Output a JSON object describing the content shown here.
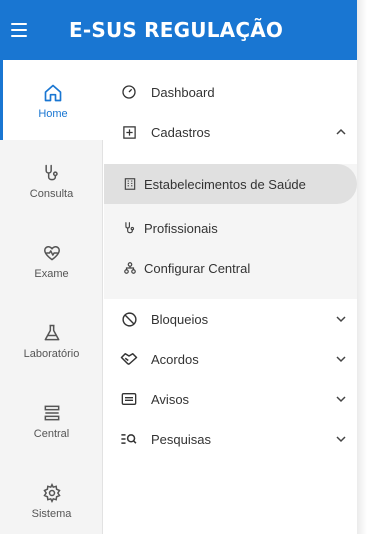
{
  "header": {
    "title": "E-SUS REGULAÇÃO",
    "menu_icon": "hamburger-icon"
  },
  "rail": {
    "items": [
      {
        "label": "Home",
        "icon": "home-icon",
        "active": true
      },
      {
        "label": "Consulta",
        "icon": "stethoscope-icon"
      },
      {
        "label": "Exame",
        "icon": "heart-pulse-icon"
      },
      {
        "label": "Laboratório",
        "icon": "flask-icon"
      },
      {
        "label": "Central",
        "icon": "central-icon"
      },
      {
        "label": "Sistema",
        "icon": "gear-icon"
      }
    ]
  },
  "menu": {
    "items": [
      {
        "label": "Dashboard",
        "icon": "gauge-icon"
      },
      {
        "label": "Cadastros",
        "icon": "plus-box-icon",
        "expanded": true
      },
      {
        "label": "Bloqueios",
        "icon": "block-icon"
      },
      {
        "label": "Acordos",
        "icon": "handshake-icon"
      },
      {
        "label": "Avisos",
        "icon": "notice-icon"
      },
      {
        "label": "Pesquisas",
        "icon": "search-list-icon"
      }
    ],
    "cadastros_sub": [
      {
        "label": "Estabelecimentos de Saúde",
        "icon": "building-icon",
        "selected": true
      },
      {
        "label": "Profissionais",
        "icon": "stethoscope-icon"
      },
      {
        "label": "Configurar Central",
        "icon": "network-icon"
      }
    ]
  },
  "colors": {
    "primary": "#1976d2",
    "rail_bg": "#f4f4f4",
    "selected_bg": "#e0e0e0"
  }
}
